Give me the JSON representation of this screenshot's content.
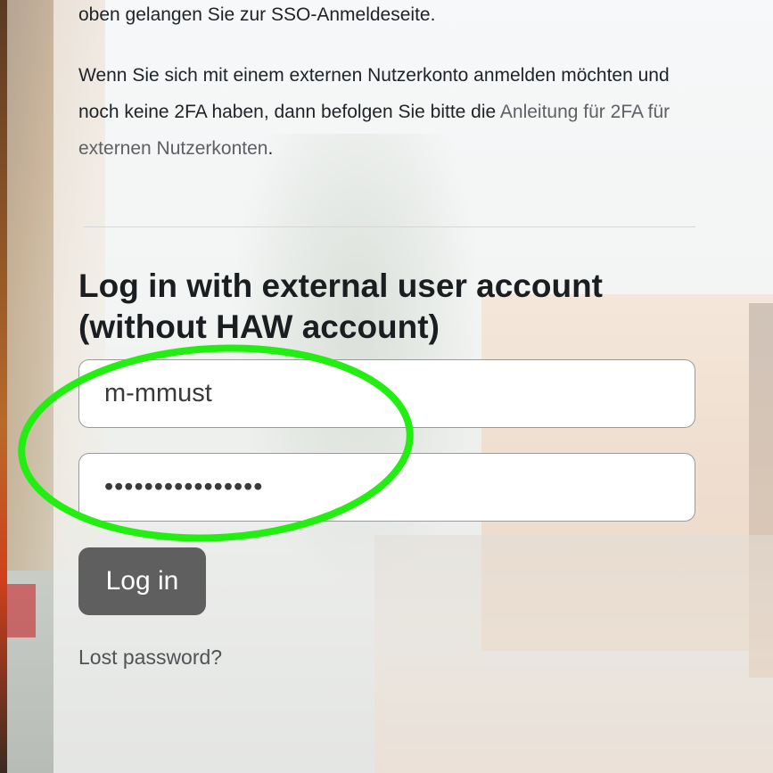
{
  "intro": {
    "line1": "oben gelangen Sie zur SSO-Anmeldeseite.",
    "p2_text": "Wenn Sie sich mit einem externen Nutzerkonto anmelden möchten und noch keine 2FA haben, dann befolgen Sie bitte die ",
    "p2_link": "Anleitung für 2FA für externen Nutzerkonten",
    "p2_end": "."
  },
  "login": {
    "heading": "Log in with external user account (without HAW account)",
    "username_value": "m-mmust",
    "password_value": "••••••••••••••••",
    "button_label": "Log in",
    "lost_password": "Lost password?"
  },
  "colors": {
    "button": "#5f5f5f",
    "marker": "#22ee11",
    "link": "#5d6064"
  }
}
